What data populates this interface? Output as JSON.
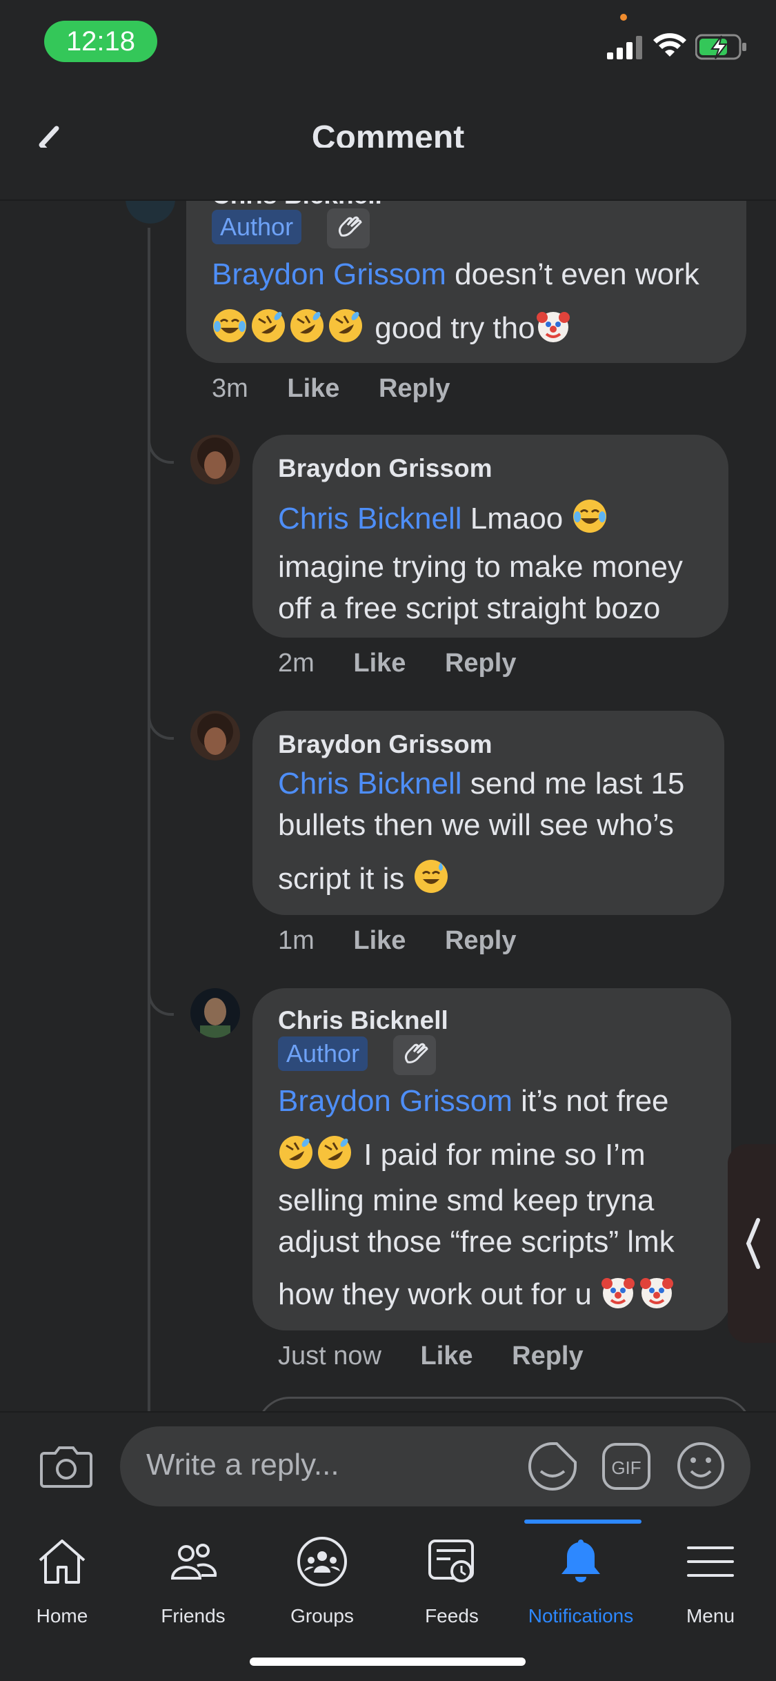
{
  "status_bar": {
    "time": "12:18"
  },
  "header": {
    "title": "Comment"
  },
  "comments": [
    {
      "name": "Chris Bicknell",
      "badge": "Author",
      "mention": "Braydon Grissom",
      "text_1": " doesn’t even work",
      "text_2": " good try tho",
      "time": "3m",
      "like": "Like",
      "reply": "Reply"
    },
    {
      "name": "Braydon Grissom",
      "mention": "Chris Bicknell",
      "text_1": " Lmaoo ",
      "line_2": "imagine trying to make money",
      "line_3": "off a free script straight bozo",
      "time": "2m",
      "like": "Like",
      "reply": "Reply"
    },
    {
      "name": "Braydon Grissom",
      "mention": "Chris Bicknell",
      "text_1": " send me last 15",
      "line_2": "bullets then we will see who’s",
      "line_3": "script it is ",
      "time": "1m",
      "like": "Like",
      "reply": "Reply"
    },
    {
      "name": "Chris Bicknell",
      "badge": "Author",
      "mention": "Braydon Grissom",
      "text_1": " it’s not free",
      "line_2": " I paid for mine so I’m",
      "line_3": "selling mine smd keep tryna",
      "line_4": "adjust those “free scripts” lmk",
      "line_5": "how they work out for u ",
      "time": "Just now",
      "like": "Like",
      "reply": "Reply"
    }
  ],
  "composer": {
    "placeholder": "Write a reply..."
  },
  "tabs": [
    {
      "label": "Home",
      "icon": "home-icon"
    },
    {
      "label": "Friends",
      "icon": "friends-icon"
    },
    {
      "label": "Groups",
      "icon": "groups-icon"
    },
    {
      "label": "Feeds",
      "icon": "feeds-icon"
    },
    {
      "label": "Notifications",
      "icon": "bell-icon",
      "active": true
    },
    {
      "label": "Menu",
      "icon": "menu-icon"
    }
  ],
  "colors": {
    "background": "#242526",
    "bubble": "#3a3b3c",
    "mention": "#4e8ef7",
    "active_tab": "#2d88ff",
    "time_pill": "#34c759"
  }
}
